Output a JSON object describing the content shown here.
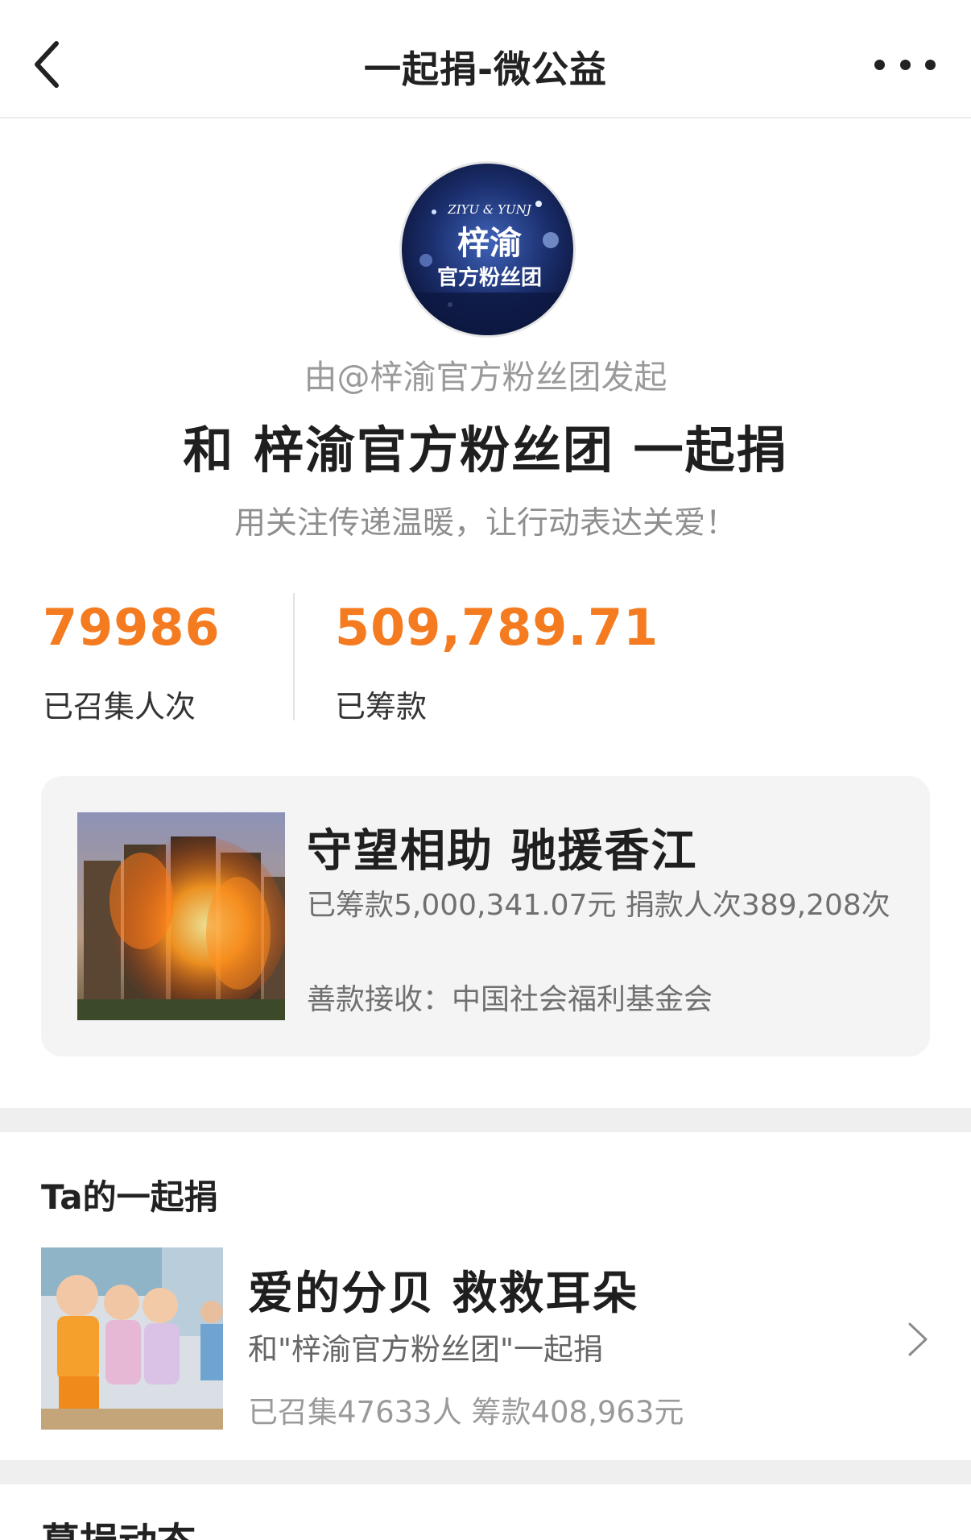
{
  "nav": {
    "title": "一起捐-微公益",
    "back_icon": "back-arrow-icon",
    "more_icon": "more-dots-icon"
  },
  "header": {
    "avatar_text_top": "ZIYU & YUNJ",
    "avatar_text_main": "梓渝",
    "avatar_text_sub": "官方粉丝团",
    "initiator": "由@梓渝官方粉丝团发起",
    "headline": "和 梓渝官方粉丝团 一起捐",
    "slogan": "用关注传递温暖，让行动表达关爱！"
  },
  "stats": {
    "people_value": "79986",
    "people_label": "已召集人次",
    "amount_value": "509,789.71",
    "amount_label": "已筹款"
  },
  "project": {
    "title": "守望相助 驰援香江",
    "stats_text": "已筹款5,000,341.07元  捐款人次389,208次",
    "receiver": "善款接收：中国社会福利基金会"
  },
  "ta_section": {
    "title": "Ta的一起捐",
    "item": {
      "title": "爱的分贝 救救耳朵",
      "with_text": "和\"梓渝官方粉丝团\"一起捐",
      "stats_text": "已召集47633人  筹款408,963元"
    }
  },
  "bottom_section": {
    "title": "募捐动态"
  },
  "colors": {
    "accent_orange": "#f47b20",
    "card_bg": "#f4f4f4",
    "separator": "#efefef"
  }
}
